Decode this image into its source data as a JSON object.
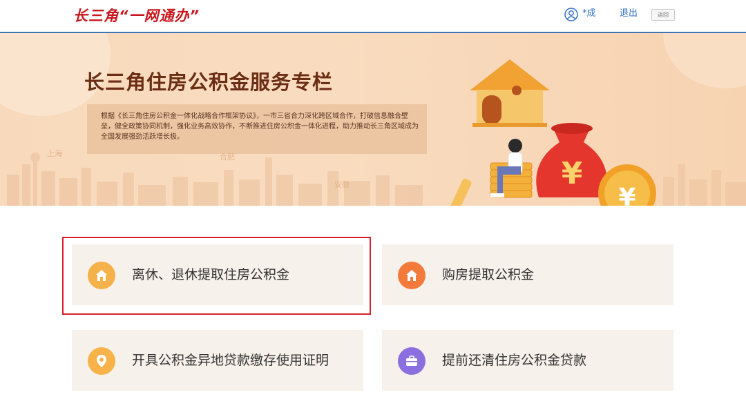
{
  "header": {
    "logo_text": "长三角“一网通办”",
    "user_name": "*成",
    "logout_label": "退出",
    "back_label": "返回"
  },
  "banner": {
    "title": "长三角住房公积金服务专栏",
    "description": "根据《长三角住房公积金一体化战略合作框架协议》，一市三省合力深化跨区域合作，打破信息融合壁垒，健全政策协同机制，强化业务高效协作，不断推进住房公积金一体化进程，助力推动长三角区域成为全国发展强劲活跃增长极。",
    "city_labels": [
      "上海",
      "合肥",
      "安徽"
    ]
  },
  "services": [
    {
      "label": "离休、退休提取住房公积金",
      "icon": "house-icon",
      "color": "#f5b14a",
      "selected": true
    },
    {
      "label": "购房提取公积金",
      "icon": "house-icon",
      "color": "#f47a3c",
      "selected": false
    },
    {
      "label": "开具公积金异地贷款缴存使用证明",
      "icon": "location-pin-icon",
      "color": "#f7b24a",
      "selected": false
    },
    {
      "label": "提前还清住房公积金贷款",
      "icon": "briefcase-icon",
      "color": "#8b6ee0",
      "selected": false
    }
  ],
  "colors": {
    "accent_blue": "#2f6fc0",
    "brand_red": "#c8161d",
    "highlight_red": "#d9202a",
    "card_bg": "#f6f1ea"
  }
}
